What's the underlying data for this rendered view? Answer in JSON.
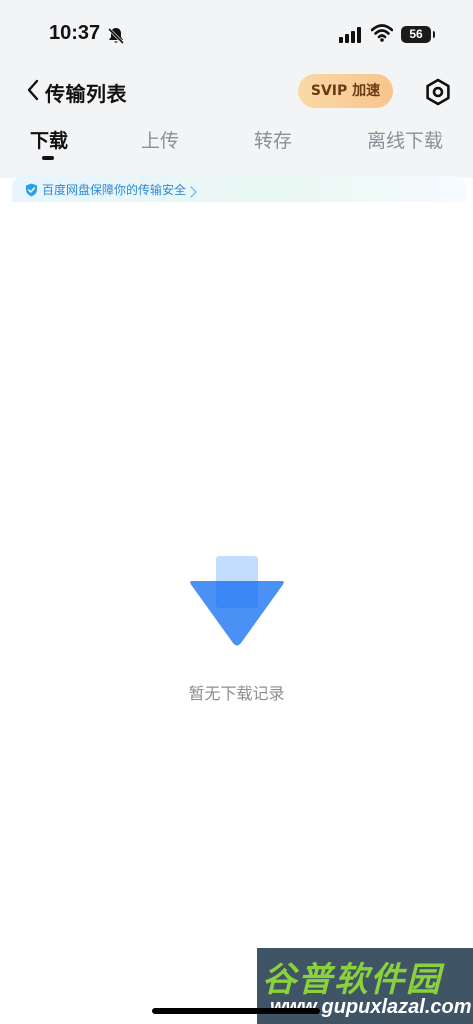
{
  "status_bar": {
    "time": "10:37",
    "battery": "56",
    "icons": [
      "bell-slash-icon",
      "cellular-signal-icon",
      "wifi-icon",
      "battery-icon"
    ]
  },
  "header": {
    "title": "传输列表",
    "svip_button": "SVIP 加速",
    "icons": [
      "chevron-left-icon",
      "settings-icon"
    ]
  },
  "tabs": [
    {
      "label": "下载",
      "active": true
    },
    {
      "label": "上传",
      "active": false
    },
    {
      "label": "转存",
      "active": false
    },
    {
      "label": "离线下载",
      "active": false
    }
  ],
  "notice": {
    "text": "百度网盘保障你的传输安全",
    "icon": "shield-check-icon"
  },
  "empty_state": {
    "text": "暂无下载记录",
    "icon": "download-arrow-icon"
  },
  "watermark": {
    "logo": "谷普软件园",
    "url": "www.gupuxlazal.com"
  },
  "colors": {
    "accent_blue": "#4a90f5",
    "svip_gold": "#f7c58d",
    "notice_text": "#2d8ad8"
  }
}
